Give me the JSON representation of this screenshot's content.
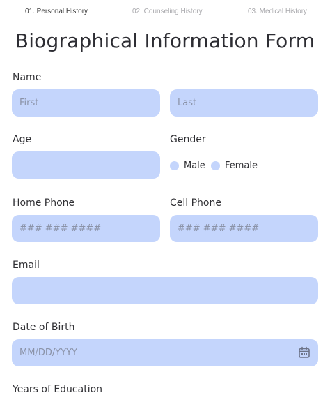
{
  "steps": [
    {
      "label": "01. Personal History"
    },
    {
      "label": "02. Counseling History"
    },
    {
      "label": "03. Medical History"
    }
  ],
  "title": "Biographical Information Form",
  "fields": {
    "name_label": "Name",
    "first_placeholder": "First",
    "last_placeholder": "Last",
    "age_label": "Age",
    "gender_label": "Gender",
    "gender_options": [
      "Male",
      "Female"
    ],
    "home_phone_label": "Home Phone",
    "home_phone_placeholder": "### ### ####",
    "cell_phone_label": "Cell Phone",
    "cell_phone_placeholder": "### ### ####",
    "email_label": "Email",
    "dob_label": "Date of Birth",
    "dob_placeholder": "MM/DD/YYYY",
    "education_label": "Years of Education"
  },
  "icons": {
    "date_picker": "calendar-icon"
  },
  "colors": {
    "field_bg": "#c4d5fc",
    "text": "#2f2f33",
    "step_inactive": "#a9a9ad"
  }
}
